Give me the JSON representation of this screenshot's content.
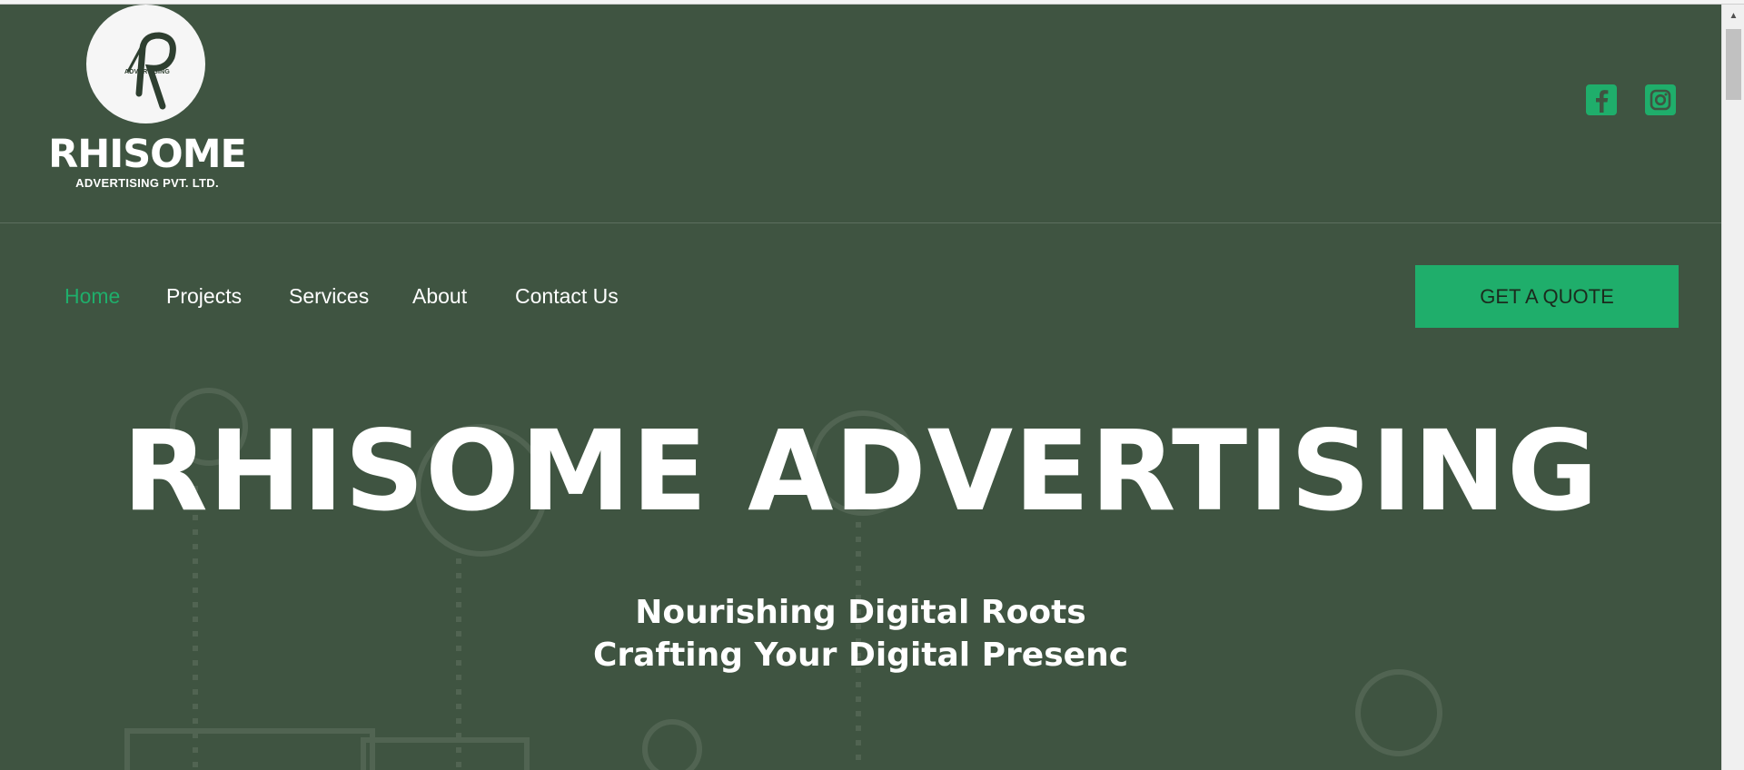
{
  "brand": {
    "circle_text": "ADVERTISING",
    "name": "RHISOME",
    "subtitle": "ADVERTISING PVT. LTD."
  },
  "social": {
    "facebook_icon": "facebook-icon",
    "instagram_icon": "instagram-icon"
  },
  "nav": {
    "items": [
      {
        "label": "Home",
        "active": true
      },
      {
        "label": "Projects"
      },
      {
        "label": "Services"
      },
      {
        "label": "About"
      },
      {
        "label": "Contact Us"
      }
    ],
    "cta_label": "GET A QUOTE"
  },
  "hero": {
    "title": "RHISOME ADVERTISING",
    "subtitle_line1": "Nourishing Digital Roots",
    "subtitle_line2": "Crafting Your Digital Presenc"
  },
  "colors": {
    "background": "#3f5441",
    "accent": "#1fae6b",
    "text": "#ffffff"
  }
}
